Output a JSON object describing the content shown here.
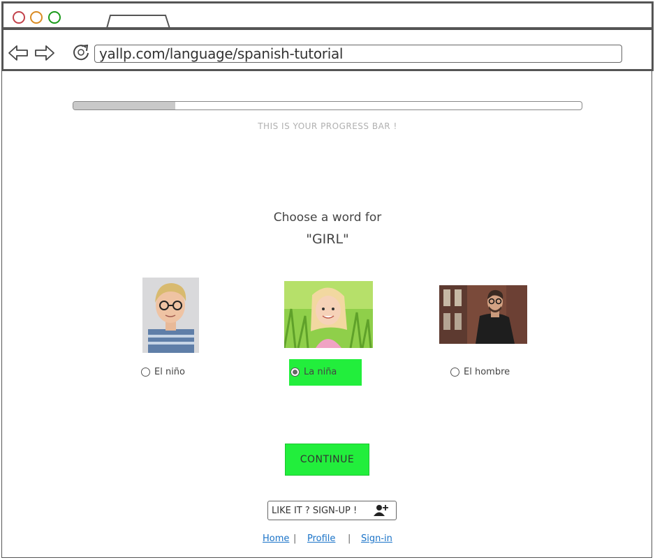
{
  "browser": {
    "url": "yallp.com/language/spanish-tutorial"
  },
  "progress": {
    "value_fraction": 0.2,
    "caption": "THIS IS YOUR PROGRESS BAR !"
  },
  "question": {
    "prompt": "Choose a word for",
    "target_word": "\"GIRL\""
  },
  "options": [
    {
      "label": "El niño",
      "selected": false,
      "image": "boy-with-glasses-photo"
    },
    {
      "label": "La niña",
      "selected": true,
      "image": "girl-in-grass-photo"
    },
    {
      "label": "El hombre",
      "selected": false,
      "image": "man-with-glasses-photo"
    }
  ],
  "colors": {
    "accent_green": "#22ee3c",
    "link_blue": "#1a73c8",
    "progress_fill": "#c9c9c9"
  },
  "actions": {
    "continue_label": "CONTINUE",
    "signup_label": "LIKE IT ? SIGN-UP !",
    "signup_icon": "add-user-icon"
  },
  "footer": {
    "links": [
      "Home",
      "Profile",
      "Sign-in"
    ],
    "separator": "|"
  }
}
